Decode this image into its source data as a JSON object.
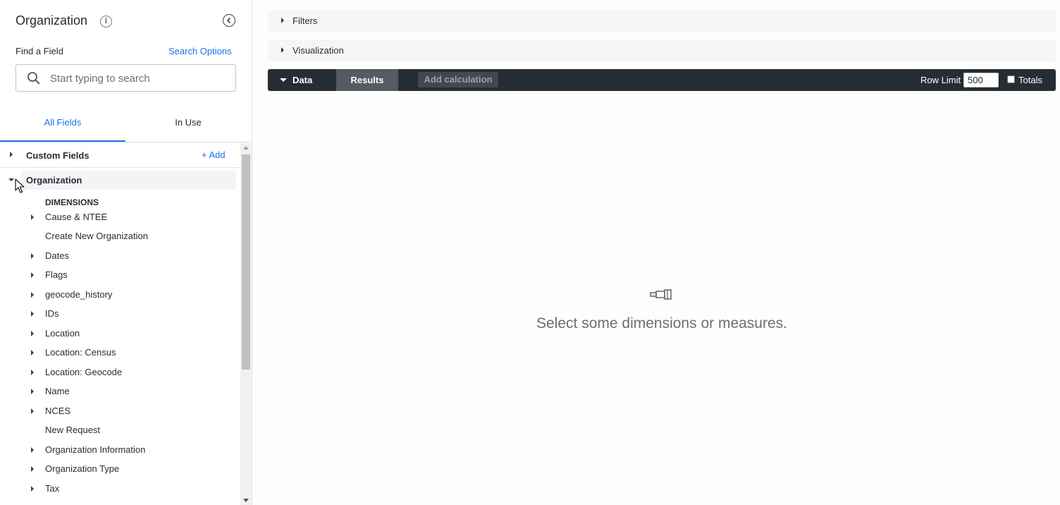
{
  "left_panel": {
    "title": "Organization",
    "find_label": "Find a Field",
    "search_options": "Search Options",
    "search_placeholder": "Start typing to search",
    "tabs": {
      "all_fields": "All Fields",
      "in_use": "In Use"
    },
    "custom_fields": {
      "label": "Custom Fields",
      "add": "+ Add"
    },
    "organization": {
      "label": "Organization"
    },
    "dimensions_header": "DIMENSIONS",
    "items": [
      {
        "label": "Cause & NTEE",
        "expandable": true
      },
      {
        "label": "Create New Organization",
        "expandable": false
      },
      {
        "label": "Dates",
        "expandable": true
      },
      {
        "label": "Flags",
        "expandable": true
      },
      {
        "label": "geocode_history",
        "expandable": true
      },
      {
        "label": "IDs",
        "expandable": true
      },
      {
        "label": "Location",
        "expandable": true
      },
      {
        "label": "Location: Census",
        "expandable": true
      },
      {
        "label": "Location: Geocode",
        "expandable": true
      },
      {
        "label": "Name",
        "expandable": true
      },
      {
        "label": "NCES",
        "expandable": true
      },
      {
        "label": "New Request",
        "expandable": false
      },
      {
        "label": "Organization Information",
        "expandable": true
      },
      {
        "label": "Organization Type",
        "expandable": true
      },
      {
        "label": "Tax",
        "expandable": true
      }
    ]
  },
  "main": {
    "filters_label": "Filters",
    "visualization_label": "Visualization",
    "data_bar": {
      "data_label": "Data",
      "results_label": "Results",
      "add_calculation": "Add calculation",
      "row_limit_label": "Row Limit",
      "row_limit_value": "500",
      "totals_label": "Totals"
    },
    "empty_message": "Select some dimensions or measures."
  },
  "colors": {
    "accent": "#1a73e8",
    "data_bar_bg": "#262d33",
    "results_tab_bg": "#555b61"
  }
}
